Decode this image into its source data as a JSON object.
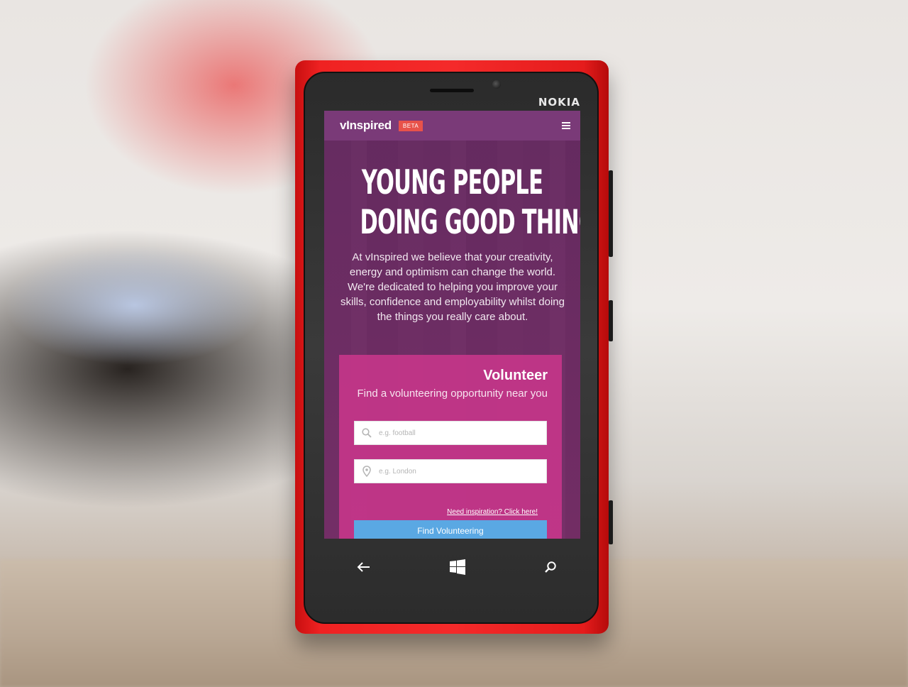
{
  "phone": {
    "brand": "NOKIA"
  },
  "site": {
    "logo": "vInspired",
    "beta_badge": "BETA",
    "menu_icon": "hamburger-menu-icon"
  },
  "hero": {
    "title_line1": "YOUNG PEOPLE",
    "title_line2": "DOING GOOD THINGS",
    "body": "At vInspired we believe that your creativity, energy and optimism can change the world. We're dedicated to helping you improve your skills, confidence and employability whilst doing the things you really care about."
  },
  "volunteer": {
    "title": "Volunteer",
    "subtitle": "Find a volunteering opportunity near you",
    "search_placeholder": "e.g. football",
    "location_placeholder": "e.g. London",
    "inspiration_link": "Need inspiration? Click here!",
    "find_button": "Find Volunteering"
  },
  "navbar": {
    "back_icon": "back-arrow-icon",
    "start_icon": "windows-logo-icon",
    "search_icon": "search-icon"
  },
  "colors": {
    "phone_body": "#f42a2a",
    "topbar": "#7a3a78",
    "beta_badge": "#e8524a",
    "card": "#cb378c",
    "button": "#5aa8e3"
  }
}
